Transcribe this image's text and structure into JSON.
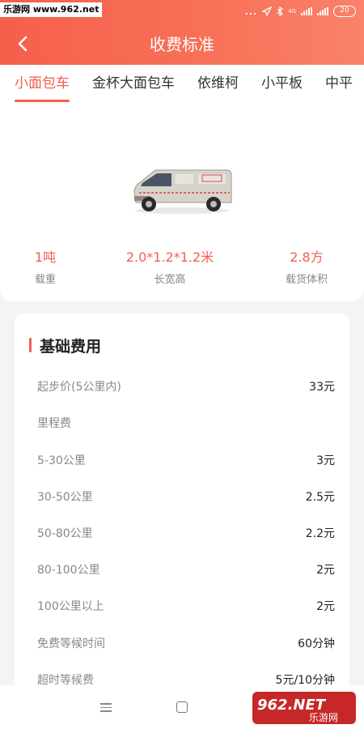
{
  "status_bar": {
    "watermark": "乐游网 www.962.net",
    "dots": "...",
    "network": "4G",
    "battery": "20"
  },
  "header": {
    "title": "收费标准"
  },
  "tabs": [
    {
      "label": "小面包车",
      "active": true
    },
    {
      "label": "金杯大面包车",
      "active": false
    },
    {
      "label": "依维柯",
      "active": false
    },
    {
      "label": "小平板",
      "active": false
    },
    {
      "label": "中平",
      "active": false
    }
  ],
  "vehicle": {
    "specs": [
      {
        "value": "1吨",
        "label": "载重"
      },
      {
        "value": "2.0*1.2*1.2米",
        "label": "长宽高"
      },
      {
        "value": "2.8方",
        "label": "载货体积"
      }
    ]
  },
  "fees": {
    "title": "基础费用",
    "rows": [
      {
        "label": "起步价(5公里内)",
        "value": "33元"
      },
      {
        "label": "里程费",
        "value": ""
      },
      {
        "label": "5-30公里",
        "value": "3元"
      },
      {
        "label": "30-50公里",
        "value": "2.5元"
      },
      {
        "label": "50-80公里",
        "value": "2.2元"
      },
      {
        "label": "80-100公里",
        "value": "2元"
      },
      {
        "label": "100公里以上",
        "value": "2元"
      },
      {
        "label": "免费等候时间",
        "value": "60分钟"
      },
      {
        "label": "超时等候费",
        "value": "5元/10分钟"
      }
    ]
  },
  "logo_watermark": {
    "text": "962.NET",
    "subtext": "乐游网"
  },
  "colors": {
    "accent": "#f2604e",
    "header_start": "#f55f4c",
    "header_end": "#f9826a"
  }
}
